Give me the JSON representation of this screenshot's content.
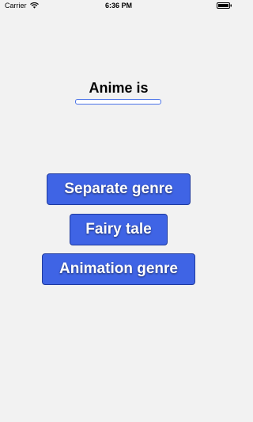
{
  "status_bar": {
    "carrier": "Carrier",
    "time": "6:36 PM"
  },
  "quiz": {
    "question": "Anime is",
    "answer_value": ""
  },
  "options": [
    {
      "label": "Separate genre"
    },
    {
      "label": "Fairy tale"
    },
    {
      "label": "Animation genre"
    }
  ],
  "colors": {
    "background": "#f2f2f2",
    "button": "#3f64e5",
    "button_border": "#1f3a9e",
    "field_border": "#4a73e8"
  }
}
